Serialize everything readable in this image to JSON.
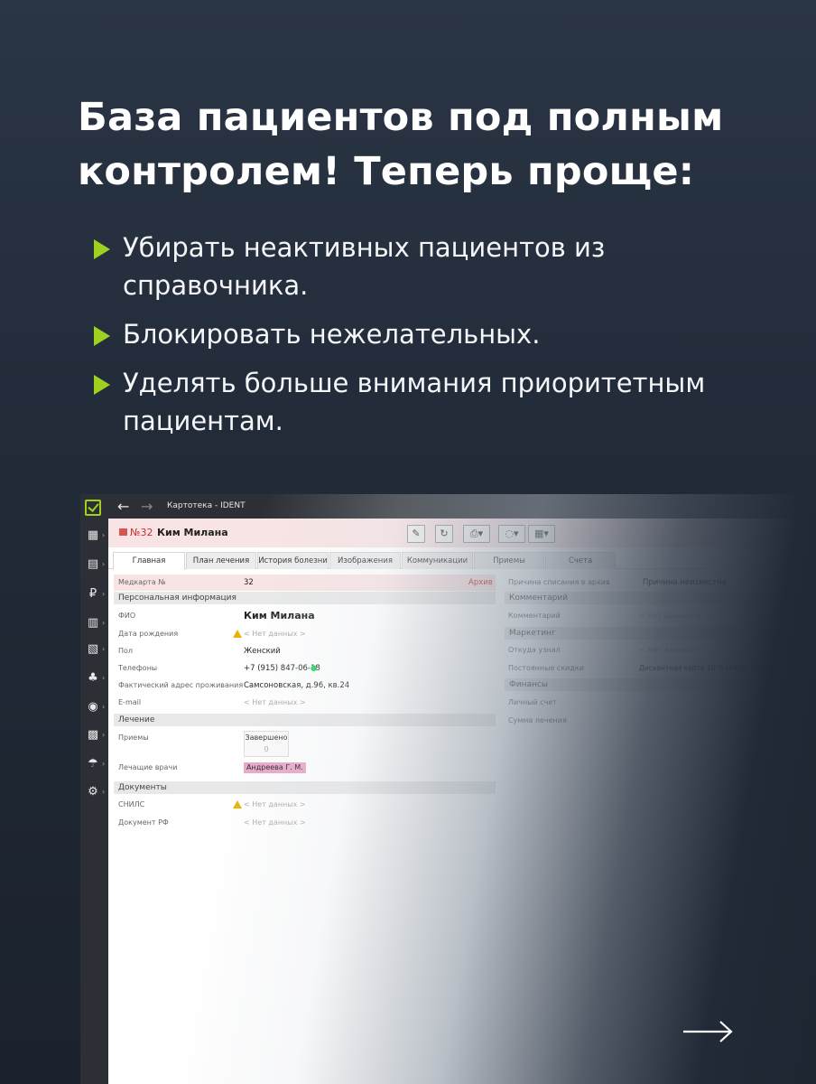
{
  "headline": "База пациентов под полным контролем! Теперь проще:",
  "bullets": [
    "Убирать неактивных пациентов из справочника.",
    "Блокировать нежелательных.",
    "Уделять больше внимания приоритетным пациентам."
  ],
  "colors": {
    "accent": "#9fd21f",
    "background": "#212a37"
  },
  "app": {
    "breadcrumb": "Картотека - IDENT",
    "record": {
      "number": "№32",
      "name": "Ким Милана"
    },
    "tabs": [
      "Главная",
      "План лечения",
      "История болезни",
      "Изображения",
      "Коммуникации",
      "Приемы",
      "Счета"
    ],
    "left": {
      "medcard_label": "Медкарта №",
      "medcard_value": "32",
      "archive": "Архив",
      "section_personal": "Персональная информация",
      "fio_label": "ФИО",
      "fio_value": "Ким Милана",
      "dob_label": "Дата рождения",
      "no_data": "< Нет данных >",
      "gender_label": "Пол",
      "gender_value": "Женский",
      "phones_label": "Телефоны",
      "phones_value": "+7 (915) 847-06-18",
      "address_label": "Фактический адрес проживания",
      "address_value": "Самсоновская, д.96, кв.24",
      "email_label": "E-mail",
      "section_treatment": "Лечение",
      "visits_label": "Приемы",
      "visits_status": "Завершено",
      "visits_count": "0",
      "doctors_label": "Лечащие врачи",
      "doctor": "Андреева Г. М.",
      "section_docs": "Документы",
      "snils_label": "СНИЛС",
      "docrf_label": "Документ РФ"
    },
    "right": {
      "reason_label": "Причина списания в архив",
      "reason_value": "Причина неизвестна",
      "section_comment": "Комментарий",
      "comment_label": "Комментарий",
      "no_data": "< Нет данных >",
      "section_marketing": "Маркетинг",
      "source_label": "Откуда узнал",
      "discount_label": "Постоянные скидки",
      "discount_value": "Дисконтная карта 10 % (0426 - 30%",
      "section_finance": "Финансы",
      "account_label": "Личный счет",
      "treatment_sum_label": "Сумма лечения"
    }
  }
}
